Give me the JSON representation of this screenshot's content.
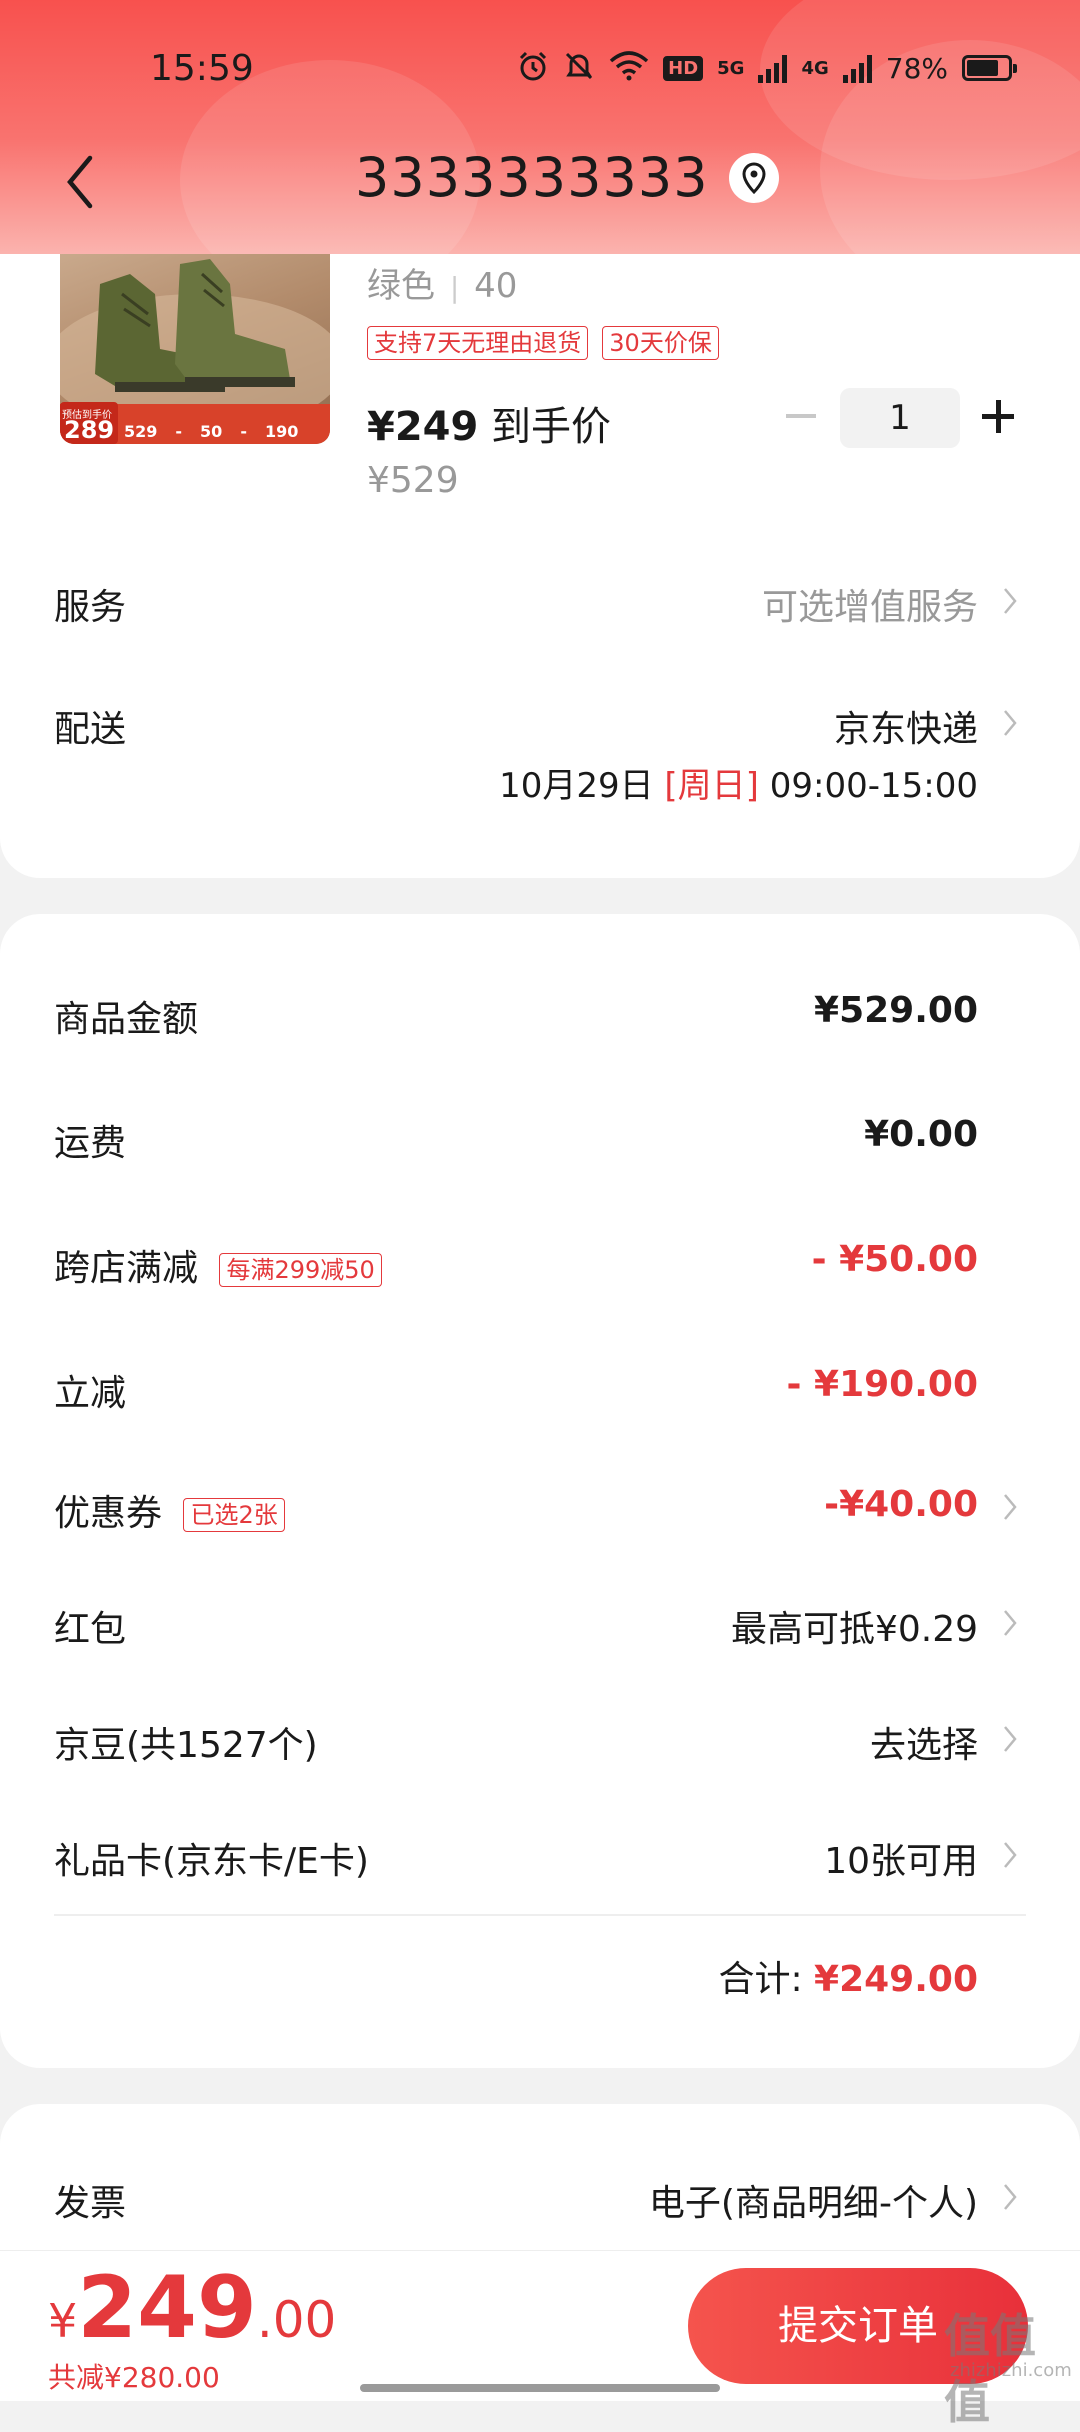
{
  "status_bar": {
    "time": "15:59",
    "network_1": "5G",
    "network_2": "4G",
    "hd_label": "HD",
    "battery_percent": "78%",
    "battery_level": 0.78
  },
  "header": {
    "title": "3333333333"
  },
  "product": {
    "variant_color": "绿色",
    "variant_separator": "|",
    "variant_size": "40",
    "tags": [
      "支持7天无理由退货",
      "30天价保"
    ],
    "price": "¥249",
    "price_suffix": "到手价",
    "original_price": "¥529",
    "quantity": "1",
    "image_overlay": {
      "badge_price": "289",
      "badge_label": "预估到手价",
      "cells": [
        "529",
        "-",
        "50",
        "-",
        "190"
      ]
    }
  },
  "service": {
    "label": "服务",
    "value": "可选增值服务"
  },
  "delivery": {
    "label": "配送",
    "value": "京东快递",
    "date": "10月29日",
    "weekday": "[周日]",
    "time_range": "09:00-15:00"
  },
  "summary": {
    "goods_amount": {
      "label": "商品金额",
      "value": "¥529.00"
    },
    "shipping": {
      "label": "运费",
      "value": "¥0.00"
    },
    "cross_store": {
      "label": "跨店满减",
      "tag": "每满299减50",
      "value": "- ¥50.00"
    },
    "instant_discount": {
      "label": "立减",
      "value": "- ¥190.00"
    },
    "coupon": {
      "label": "优惠券",
      "tag": "已选2张",
      "value": "-¥40.00"
    },
    "red_packet": {
      "label": "红包",
      "value": "最高可抵¥0.29"
    },
    "jd_beans": {
      "label": "京豆(共1527个)",
      "value": "去选择"
    },
    "gift_card": {
      "label": "礼品卡(京东卡/E卡)",
      "value": "10张可用"
    },
    "total_label": "合计:",
    "total_value": "¥249.00"
  },
  "invoice": {
    "label": "发票",
    "value": "电子(商品明细-个人)"
  },
  "bottom_bar": {
    "currency": "¥",
    "amount_int": "249",
    "amount_dec": ".00",
    "saved": "共减¥280.00",
    "submit_label": "提交订单"
  },
  "watermark": {
    "text": "值值值",
    "sub": "zhizhizhi.com"
  },
  "colors": {
    "accent": "#e4393c",
    "header_top": "#f8514e",
    "header_bottom": "#fbb3ae",
    "background": "#f2f2f2"
  }
}
